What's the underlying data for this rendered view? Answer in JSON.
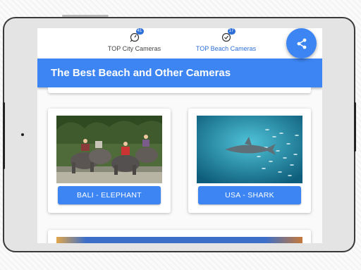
{
  "tabs": [
    {
      "label": "TOP City Cameras",
      "badge": "41",
      "icon": "city-camera-icon"
    },
    {
      "label": "TOP Beach Cameras",
      "badge": "17",
      "icon": "beach-check-icon"
    }
  ],
  "appbar": {
    "title": "The Best Beach and Other Cameras"
  },
  "fab": {
    "icon": "share-icon"
  },
  "cards": [
    {
      "button_label": "BALI - ELEPHANT",
      "image": "elephants-photo"
    },
    {
      "button_label": "USA - SHARK",
      "image": "shark-photo"
    }
  ],
  "colors": {
    "accent": "#3d85f2",
    "active_tab": "#2f6fd8"
  }
}
